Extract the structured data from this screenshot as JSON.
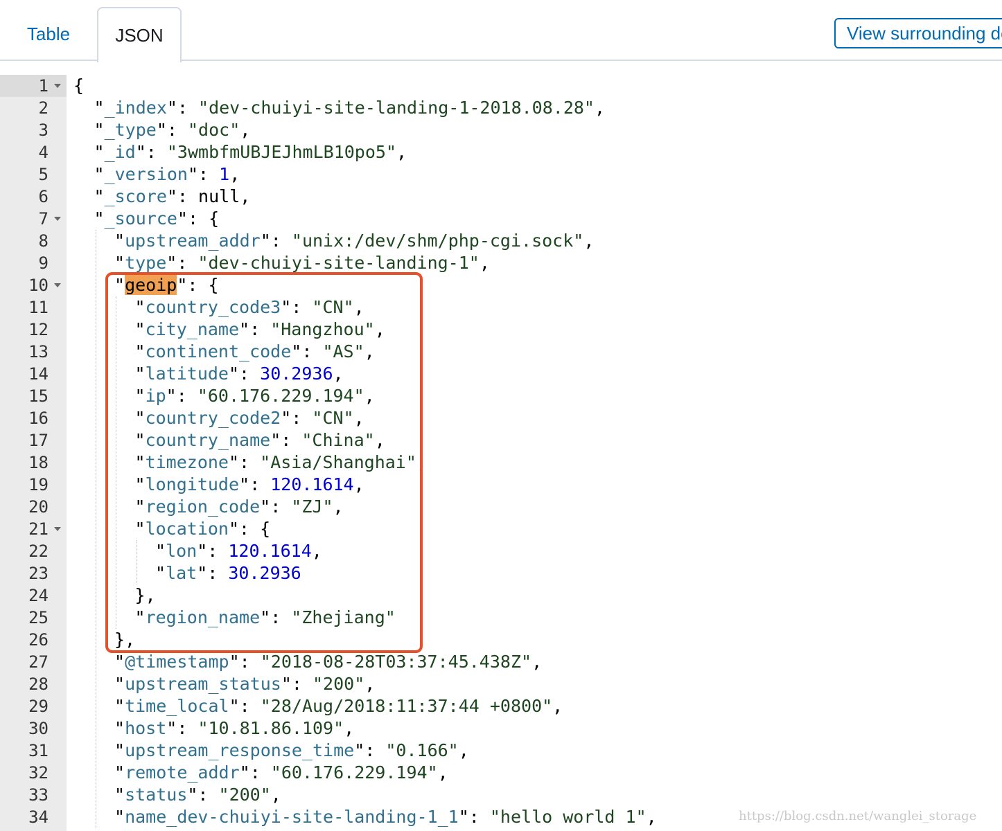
{
  "tabs": [
    {
      "label": "Table",
      "active": false
    },
    {
      "label": "JSON",
      "active": true
    }
  ],
  "view_button_label": "View surrounding documents",
  "watermark": "https://blog.csdn.net/wanglei_storage",
  "highlight_color": "#e6502a",
  "lines": [
    {
      "n": "1",
      "fold": true,
      "indent": 0,
      "parts": [
        {
          "t": "p",
          "v": "{"
        }
      ]
    },
    {
      "n": "2",
      "indent": 1,
      "parts": [
        {
          "t": "p",
          "v": "\""
        },
        {
          "t": "k",
          "v": "_index"
        },
        {
          "t": "p",
          "v": "\": "
        },
        {
          "t": "s",
          "v": "\"dev-chuiyi-site-landing-1-2018.08.28\""
        },
        {
          "t": "p",
          "v": ","
        }
      ]
    },
    {
      "n": "3",
      "indent": 1,
      "parts": [
        {
          "t": "p",
          "v": "\""
        },
        {
          "t": "k",
          "v": "_type"
        },
        {
          "t": "p",
          "v": "\": "
        },
        {
          "t": "s",
          "v": "\"doc\""
        },
        {
          "t": "p",
          "v": ","
        }
      ]
    },
    {
      "n": "4",
      "indent": 1,
      "parts": [
        {
          "t": "p",
          "v": "\""
        },
        {
          "t": "k",
          "v": "_id"
        },
        {
          "t": "p",
          "v": "\": "
        },
        {
          "t": "s",
          "v": "\"3wmbfmUBJEJhmLB10po5\""
        },
        {
          "t": "p",
          "v": ","
        }
      ]
    },
    {
      "n": "5",
      "indent": 1,
      "parts": [
        {
          "t": "p",
          "v": "\""
        },
        {
          "t": "k",
          "v": "_version"
        },
        {
          "t": "p",
          "v": "\": "
        },
        {
          "t": "n",
          "v": "1"
        },
        {
          "t": "p",
          "v": ","
        }
      ]
    },
    {
      "n": "6",
      "indent": 1,
      "parts": [
        {
          "t": "p",
          "v": "\""
        },
        {
          "t": "k",
          "v": "_score"
        },
        {
          "t": "p",
          "v": "\": null,"
        }
      ]
    },
    {
      "n": "7",
      "fold": true,
      "indent": 1,
      "parts": [
        {
          "t": "p",
          "v": "\""
        },
        {
          "t": "k",
          "v": "_source"
        },
        {
          "t": "p",
          "v": "\": {"
        }
      ]
    },
    {
      "n": "8",
      "indent": 2,
      "parts": [
        {
          "t": "p",
          "v": "\""
        },
        {
          "t": "k",
          "v": "upstream_addr"
        },
        {
          "t": "p",
          "v": "\": "
        },
        {
          "t": "s",
          "v": "\"unix:/dev/shm/php-cgi.sock\""
        },
        {
          "t": "p",
          "v": ","
        }
      ]
    },
    {
      "n": "9",
      "indent": 2,
      "parts": [
        {
          "t": "p",
          "v": "\""
        },
        {
          "t": "k",
          "v": "type"
        },
        {
          "t": "p",
          "v": "\": "
        },
        {
          "t": "s",
          "v": "\"dev-chuiyi-site-landing-1\""
        },
        {
          "t": "p",
          "v": ","
        }
      ]
    },
    {
      "n": "10",
      "fold": true,
      "indent": 2,
      "parts": [
        {
          "t": "p",
          "v": "\""
        },
        {
          "t": "h",
          "v": "geoip"
        },
        {
          "t": "p",
          "v": "\": {"
        }
      ]
    },
    {
      "n": "11",
      "indent": 3,
      "parts": [
        {
          "t": "p",
          "v": "\""
        },
        {
          "t": "k",
          "v": "country_code3"
        },
        {
          "t": "p",
          "v": "\": "
        },
        {
          "t": "s",
          "v": "\"CN\""
        },
        {
          "t": "p",
          "v": ","
        }
      ]
    },
    {
      "n": "12",
      "indent": 3,
      "parts": [
        {
          "t": "p",
          "v": "\""
        },
        {
          "t": "k",
          "v": "city_name"
        },
        {
          "t": "p",
          "v": "\": "
        },
        {
          "t": "s",
          "v": "\"Hangzhou\""
        },
        {
          "t": "p",
          "v": ","
        }
      ]
    },
    {
      "n": "13",
      "indent": 3,
      "parts": [
        {
          "t": "p",
          "v": "\""
        },
        {
          "t": "k",
          "v": "continent_code"
        },
        {
          "t": "p",
          "v": "\": "
        },
        {
          "t": "s",
          "v": "\"AS\""
        },
        {
          "t": "p",
          "v": ","
        }
      ]
    },
    {
      "n": "14",
      "indent": 3,
      "parts": [
        {
          "t": "p",
          "v": "\""
        },
        {
          "t": "k",
          "v": "latitude"
        },
        {
          "t": "p",
          "v": "\": "
        },
        {
          "t": "n",
          "v": "30.2936"
        },
        {
          "t": "p",
          "v": ","
        }
      ]
    },
    {
      "n": "15",
      "indent": 3,
      "parts": [
        {
          "t": "p",
          "v": "\""
        },
        {
          "t": "k",
          "v": "ip"
        },
        {
          "t": "p",
          "v": "\": "
        },
        {
          "t": "s",
          "v": "\"60.176.229.194\""
        },
        {
          "t": "p",
          "v": ","
        }
      ]
    },
    {
      "n": "16",
      "indent": 3,
      "parts": [
        {
          "t": "p",
          "v": "\""
        },
        {
          "t": "k",
          "v": "country_code2"
        },
        {
          "t": "p",
          "v": "\": "
        },
        {
          "t": "s",
          "v": "\"CN\""
        },
        {
          "t": "p",
          "v": ","
        }
      ]
    },
    {
      "n": "17",
      "indent": 3,
      "parts": [
        {
          "t": "p",
          "v": "\""
        },
        {
          "t": "k",
          "v": "country_name"
        },
        {
          "t": "p",
          "v": "\": "
        },
        {
          "t": "s",
          "v": "\"China\""
        },
        {
          "t": "p",
          "v": ","
        }
      ]
    },
    {
      "n": "18",
      "indent": 3,
      "parts": [
        {
          "t": "p",
          "v": "\""
        },
        {
          "t": "k",
          "v": "timezone"
        },
        {
          "t": "p",
          "v": "\": "
        },
        {
          "t": "s",
          "v": "\"Asia/Shanghai\""
        },
        {
          "t": "p",
          "v": ","
        }
      ]
    },
    {
      "n": "19",
      "indent": 3,
      "parts": [
        {
          "t": "p",
          "v": "\""
        },
        {
          "t": "k",
          "v": "longitude"
        },
        {
          "t": "p",
          "v": "\": "
        },
        {
          "t": "n",
          "v": "120.1614"
        },
        {
          "t": "p",
          "v": ","
        }
      ]
    },
    {
      "n": "20",
      "indent": 3,
      "parts": [
        {
          "t": "p",
          "v": "\""
        },
        {
          "t": "k",
          "v": "region_code"
        },
        {
          "t": "p",
          "v": "\": "
        },
        {
          "t": "s",
          "v": "\"ZJ\""
        },
        {
          "t": "p",
          "v": ","
        }
      ]
    },
    {
      "n": "21",
      "fold": true,
      "indent": 3,
      "parts": [
        {
          "t": "p",
          "v": "\""
        },
        {
          "t": "k",
          "v": "location"
        },
        {
          "t": "p",
          "v": "\": {"
        }
      ]
    },
    {
      "n": "22",
      "indent": 4,
      "parts": [
        {
          "t": "p",
          "v": "\""
        },
        {
          "t": "k",
          "v": "lon"
        },
        {
          "t": "p",
          "v": "\": "
        },
        {
          "t": "n",
          "v": "120.1614"
        },
        {
          "t": "p",
          "v": ","
        }
      ]
    },
    {
      "n": "23",
      "indent": 4,
      "parts": [
        {
          "t": "p",
          "v": "\""
        },
        {
          "t": "k",
          "v": "lat"
        },
        {
          "t": "p",
          "v": "\": "
        },
        {
          "t": "n",
          "v": "30.2936"
        }
      ]
    },
    {
      "n": "24",
      "indent": 3,
      "parts": [
        {
          "t": "p",
          "v": "},"
        }
      ]
    },
    {
      "n": "25",
      "indent": 3,
      "parts": [
        {
          "t": "p",
          "v": "\""
        },
        {
          "t": "k",
          "v": "region_name"
        },
        {
          "t": "p",
          "v": "\": "
        },
        {
          "t": "s",
          "v": "\"Zhejiang\""
        }
      ]
    },
    {
      "n": "26",
      "indent": 2,
      "parts": [
        {
          "t": "p",
          "v": "},"
        }
      ]
    },
    {
      "n": "27",
      "indent": 2,
      "parts": [
        {
          "t": "p",
          "v": "\""
        },
        {
          "t": "k",
          "v": "@timestamp"
        },
        {
          "t": "p",
          "v": "\": "
        },
        {
          "t": "s",
          "v": "\"2018-08-28T03:37:45.438Z\""
        },
        {
          "t": "p",
          "v": ","
        }
      ]
    },
    {
      "n": "28",
      "indent": 2,
      "parts": [
        {
          "t": "p",
          "v": "\""
        },
        {
          "t": "k",
          "v": "upstream_status"
        },
        {
          "t": "p",
          "v": "\": "
        },
        {
          "t": "s",
          "v": "\"200\""
        },
        {
          "t": "p",
          "v": ","
        }
      ]
    },
    {
      "n": "29",
      "indent": 2,
      "parts": [
        {
          "t": "p",
          "v": "\""
        },
        {
          "t": "k",
          "v": "time_local"
        },
        {
          "t": "p",
          "v": "\": "
        },
        {
          "t": "s",
          "v": "\"28/Aug/2018:11:37:44 +0800\""
        },
        {
          "t": "p",
          "v": ","
        }
      ]
    },
    {
      "n": "30",
      "indent": 2,
      "parts": [
        {
          "t": "p",
          "v": "\""
        },
        {
          "t": "k",
          "v": "host"
        },
        {
          "t": "p",
          "v": "\": "
        },
        {
          "t": "s",
          "v": "\"10.81.86.109\""
        },
        {
          "t": "p",
          "v": ","
        }
      ]
    },
    {
      "n": "31",
      "indent": 2,
      "parts": [
        {
          "t": "p",
          "v": "\""
        },
        {
          "t": "k",
          "v": "upstream_response_time"
        },
        {
          "t": "p",
          "v": "\": "
        },
        {
          "t": "s",
          "v": "\"0.166\""
        },
        {
          "t": "p",
          "v": ","
        }
      ]
    },
    {
      "n": "32",
      "indent": 2,
      "parts": [
        {
          "t": "p",
          "v": "\""
        },
        {
          "t": "k",
          "v": "remote_addr"
        },
        {
          "t": "p",
          "v": "\": "
        },
        {
          "t": "s",
          "v": "\"60.176.229.194\""
        },
        {
          "t": "p",
          "v": ","
        }
      ]
    },
    {
      "n": "33",
      "indent": 2,
      "parts": [
        {
          "t": "p",
          "v": "\""
        },
        {
          "t": "k",
          "v": "status"
        },
        {
          "t": "p",
          "v": "\": "
        },
        {
          "t": "s",
          "v": "\"200\""
        },
        {
          "t": "p",
          "v": ","
        }
      ]
    },
    {
      "n": "34",
      "indent": 2,
      "parts": [
        {
          "t": "p",
          "v": "\""
        },
        {
          "t": "k",
          "v": "name_dev-chuiyi-site-landing-1_1"
        },
        {
          "t": "p",
          "v": "\": "
        },
        {
          "t": "s",
          "v": "\"hello world 1\""
        },
        {
          "t": "p",
          "v": ","
        }
      ]
    }
  ]
}
